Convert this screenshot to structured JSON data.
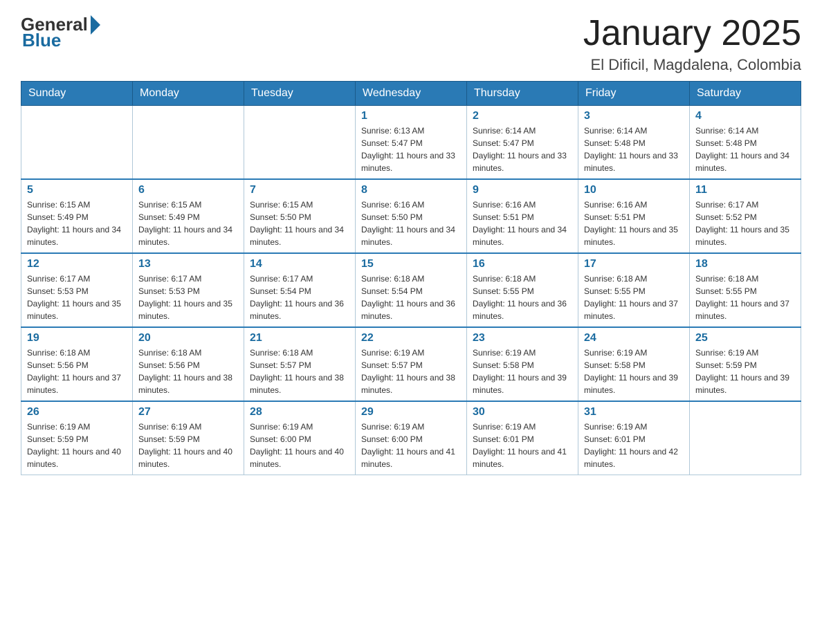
{
  "header": {
    "logo": {
      "general": "General",
      "blue": "Blue"
    },
    "title": "January 2025",
    "subtitle": "El Dificil, Magdalena, Colombia"
  },
  "calendar": {
    "days_of_week": [
      "Sunday",
      "Monday",
      "Tuesday",
      "Wednesday",
      "Thursday",
      "Friday",
      "Saturday"
    ],
    "weeks": [
      [
        {
          "day": "",
          "info": ""
        },
        {
          "day": "",
          "info": ""
        },
        {
          "day": "",
          "info": ""
        },
        {
          "day": "1",
          "info": "Sunrise: 6:13 AM\nSunset: 5:47 PM\nDaylight: 11 hours and 33 minutes."
        },
        {
          "day": "2",
          "info": "Sunrise: 6:14 AM\nSunset: 5:47 PM\nDaylight: 11 hours and 33 minutes."
        },
        {
          "day": "3",
          "info": "Sunrise: 6:14 AM\nSunset: 5:48 PM\nDaylight: 11 hours and 33 minutes."
        },
        {
          "day": "4",
          "info": "Sunrise: 6:14 AM\nSunset: 5:48 PM\nDaylight: 11 hours and 34 minutes."
        }
      ],
      [
        {
          "day": "5",
          "info": "Sunrise: 6:15 AM\nSunset: 5:49 PM\nDaylight: 11 hours and 34 minutes."
        },
        {
          "day": "6",
          "info": "Sunrise: 6:15 AM\nSunset: 5:49 PM\nDaylight: 11 hours and 34 minutes."
        },
        {
          "day": "7",
          "info": "Sunrise: 6:15 AM\nSunset: 5:50 PM\nDaylight: 11 hours and 34 minutes."
        },
        {
          "day": "8",
          "info": "Sunrise: 6:16 AM\nSunset: 5:50 PM\nDaylight: 11 hours and 34 minutes."
        },
        {
          "day": "9",
          "info": "Sunrise: 6:16 AM\nSunset: 5:51 PM\nDaylight: 11 hours and 34 minutes."
        },
        {
          "day": "10",
          "info": "Sunrise: 6:16 AM\nSunset: 5:51 PM\nDaylight: 11 hours and 35 minutes."
        },
        {
          "day": "11",
          "info": "Sunrise: 6:17 AM\nSunset: 5:52 PM\nDaylight: 11 hours and 35 minutes."
        }
      ],
      [
        {
          "day": "12",
          "info": "Sunrise: 6:17 AM\nSunset: 5:53 PM\nDaylight: 11 hours and 35 minutes."
        },
        {
          "day": "13",
          "info": "Sunrise: 6:17 AM\nSunset: 5:53 PM\nDaylight: 11 hours and 35 minutes."
        },
        {
          "day": "14",
          "info": "Sunrise: 6:17 AM\nSunset: 5:54 PM\nDaylight: 11 hours and 36 minutes."
        },
        {
          "day": "15",
          "info": "Sunrise: 6:18 AM\nSunset: 5:54 PM\nDaylight: 11 hours and 36 minutes."
        },
        {
          "day": "16",
          "info": "Sunrise: 6:18 AM\nSunset: 5:55 PM\nDaylight: 11 hours and 36 minutes."
        },
        {
          "day": "17",
          "info": "Sunrise: 6:18 AM\nSunset: 5:55 PM\nDaylight: 11 hours and 37 minutes."
        },
        {
          "day": "18",
          "info": "Sunrise: 6:18 AM\nSunset: 5:55 PM\nDaylight: 11 hours and 37 minutes."
        }
      ],
      [
        {
          "day": "19",
          "info": "Sunrise: 6:18 AM\nSunset: 5:56 PM\nDaylight: 11 hours and 37 minutes."
        },
        {
          "day": "20",
          "info": "Sunrise: 6:18 AM\nSunset: 5:56 PM\nDaylight: 11 hours and 38 minutes."
        },
        {
          "day": "21",
          "info": "Sunrise: 6:18 AM\nSunset: 5:57 PM\nDaylight: 11 hours and 38 minutes."
        },
        {
          "day": "22",
          "info": "Sunrise: 6:19 AM\nSunset: 5:57 PM\nDaylight: 11 hours and 38 minutes."
        },
        {
          "day": "23",
          "info": "Sunrise: 6:19 AM\nSunset: 5:58 PM\nDaylight: 11 hours and 39 minutes."
        },
        {
          "day": "24",
          "info": "Sunrise: 6:19 AM\nSunset: 5:58 PM\nDaylight: 11 hours and 39 minutes."
        },
        {
          "day": "25",
          "info": "Sunrise: 6:19 AM\nSunset: 5:59 PM\nDaylight: 11 hours and 39 minutes."
        }
      ],
      [
        {
          "day": "26",
          "info": "Sunrise: 6:19 AM\nSunset: 5:59 PM\nDaylight: 11 hours and 40 minutes."
        },
        {
          "day": "27",
          "info": "Sunrise: 6:19 AM\nSunset: 5:59 PM\nDaylight: 11 hours and 40 minutes."
        },
        {
          "day": "28",
          "info": "Sunrise: 6:19 AM\nSunset: 6:00 PM\nDaylight: 11 hours and 40 minutes."
        },
        {
          "day": "29",
          "info": "Sunrise: 6:19 AM\nSunset: 6:00 PM\nDaylight: 11 hours and 41 minutes."
        },
        {
          "day": "30",
          "info": "Sunrise: 6:19 AM\nSunset: 6:01 PM\nDaylight: 11 hours and 41 minutes."
        },
        {
          "day": "31",
          "info": "Sunrise: 6:19 AM\nSunset: 6:01 PM\nDaylight: 11 hours and 42 minutes."
        },
        {
          "day": "",
          "info": ""
        }
      ]
    ]
  }
}
